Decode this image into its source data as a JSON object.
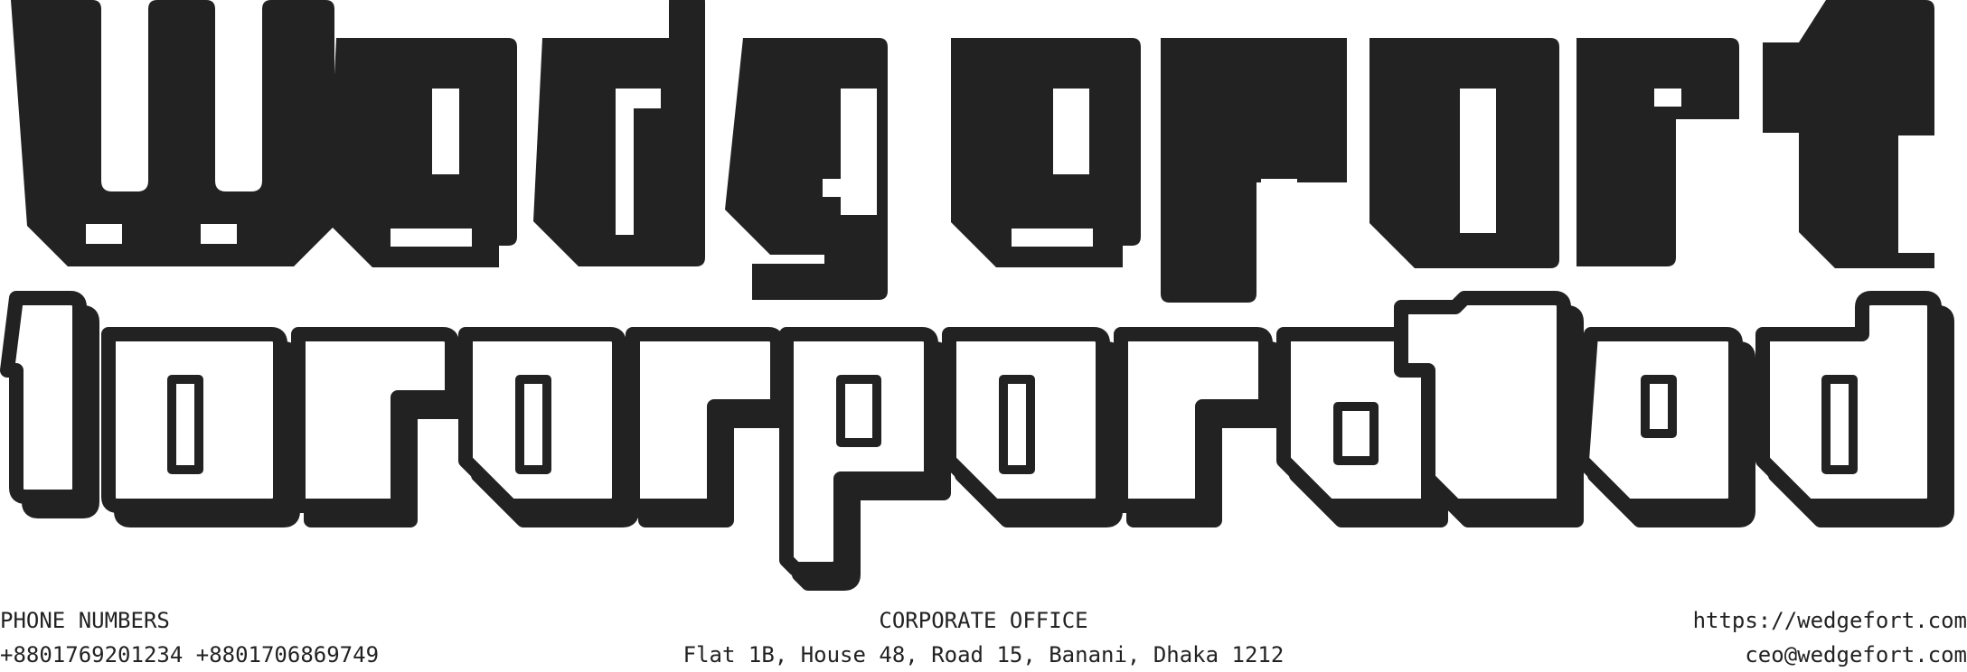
{
  "logo": {
    "line1": "Wedgefort",
    "line2": "Incorporated",
    "ink_color": "#222222",
    "paper_color": "#ffffff"
  },
  "footer": {
    "phone": {
      "heading": "PHONE NUMBERS",
      "numbers": "+8801769201234 +8801706869749"
    },
    "office": {
      "heading": "CORPORATE OFFICE",
      "address": "Flat 1B, House 48, Road 15, Banani, Dhaka 1212"
    },
    "contact": {
      "website": "https://wedgefort.com",
      "email": "ceo@wedgefort.com"
    }
  }
}
